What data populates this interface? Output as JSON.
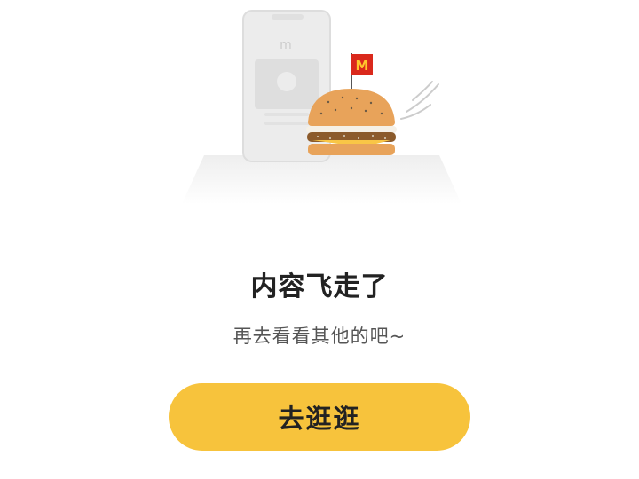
{
  "illustration": {
    "flag_logo": "M",
    "phone_logo": "m",
    "brand_color": "#da291c",
    "logo_color": "#ffc72c"
  },
  "empty_state": {
    "title": "内容飞走了",
    "subtitle": "再去看看其他的吧~"
  },
  "action": {
    "button_label": "去逛逛",
    "button_color": "#f7c33c"
  }
}
